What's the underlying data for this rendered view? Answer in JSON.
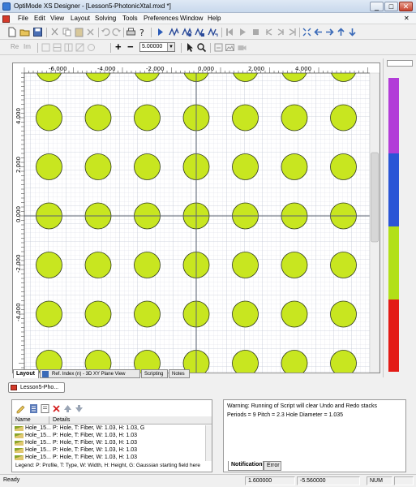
{
  "window": {
    "title": "OptiMode XS Designer  - [Lesson5-PhotonicXtal.mxd *]",
    "minimize": "_",
    "maximize": "□",
    "close": "✕"
  },
  "menu": [
    "File",
    "Edit",
    "View",
    "Layout",
    "Solving",
    "Tools",
    "Preferences",
    "Window",
    "Help"
  ],
  "toolbar": {
    "re_label": "Re",
    "im_label": "Im",
    "zoom_in": "+",
    "zoom_out": "−",
    "zoom_value": "5.00000"
  },
  "canvas": {
    "x_ticks": [
      "-6.000",
      "-4.000",
      "-2.000",
      "0.000",
      "2.000",
      "4.000"
    ],
    "y_ticks": [
      "4.000",
      "2.000",
      "0.000",
      "-2.000",
      "-4.000"
    ],
    "hole_color": "#c8e620"
  },
  "right_panel": {
    "bands": [
      "#b23dd8",
      "#2a55d6",
      "#b2e018",
      "#e31b16"
    ]
  },
  "view_tabs": [
    "Layout",
    "Ref. Index (n) - 3D XY Plane View",
    "Scripting",
    "Notes"
  ],
  "doc_tab": "Lesson5-Pho...",
  "list": {
    "col_name": "Name",
    "col_details": "Details",
    "rows": [
      {
        "name": "Hole_15...",
        "details": "P: Hole, T: Fiber, W: 1.03, H: 1.03, G"
      },
      {
        "name": "Hole_15...",
        "details": "P: Hole, T: Fiber, W: 1.03, H: 1.03"
      },
      {
        "name": "Hole_15...",
        "details": "P: Hole, T: Fiber, W: 1.03, H: 1.03"
      },
      {
        "name": "Hole_15...",
        "details": "P: Hole, T: Fiber, W: 1.03, H: 1.03"
      },
      {
        "name": "Hole_15...",
        "details": "P: Hole, T: Fiber, W: 1.03, H: 1.03"
      }
    ],
    "legend": "Legend: P: Profile, T: Type, W: Width, H: Height, G: Gaussian starting field here"
  },
  "notification": {
    "line1": "Warning: Running of Script will clear Undo and Redo stacks",
    "line2": "Periods = 9   Pitch = 2.3    Hole Diameter = 1.035",
    "tab_notification": "Notification",
    "tab_error": "Error"
  },
  "status": {
    "ready": "Ready",
    "x": "1.600000",
    "y": "-5.560000",
    "num": "NUM"
  }
}
